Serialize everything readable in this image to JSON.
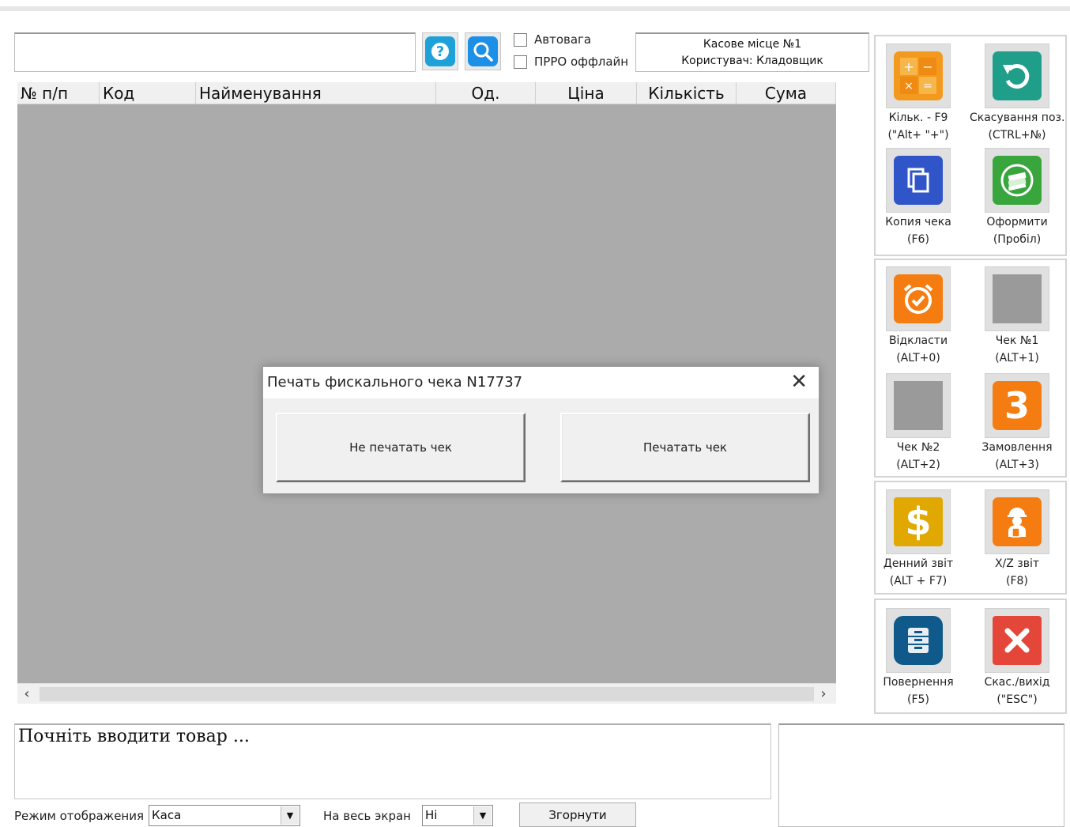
{
  "toolbar": {
    "search_value": "",
    "autoweight_label": "Автовага",
    "prro_offline_label": "ПРРО оффлайн"
  },
  "cash_info": {
    "place": "Касове місце №1",
    "user": "Користувач: Кладовщик"
  },
  "table": {
    "columns": [
      "№ п/п",
      "Код",
      "Найменування",
      "Од.",
      "Ціна",
      "Кількість",
      "Сума"
    ],
    "rows": []
  },
  "dialog": {
    "title": "Печать фискального чека N17737",
    "no_print_label": "Не печатать чек",
    "print_label": "Печатать чек"
  },
  "right_panel": {
    "buttons": [
      {
        "name": "qty",
        "line1": "Кільк. - F9",
        "line2": "(\"Alt+ \"+\")",
        "icon": "calculator-icon",
        "color": "#f39a1e"
      },
      {
        "name": "cancel-position",
        "line1": "Скасування поз.",
        "line2": "(CTRL+№)",
        "icon": "undo-icon",
        "color": "#1f9e8a"
      },
      {
        "name": "copy-receipt",
        "line1": "Копия чека",
        "line2": "(F6)",
        "icon": "copy-icon",
        "color": "#2f55c8"
      },
      {
        "name": "checkout",
        "line1": "Оформити",
        "line2": "(Пробіл)",
        "icon": "cash-stack-icon",
        "color": "#38a63c"
      },
      {
        "name": "postpone",
        "line1": "Відкласти",
        "line2": "(ALT+0)",
        "icon": "alarm-clock-icon",
        "color": "#f57c10"
      },
      {
        "name": "receipt-1",
        "line1": "Чек №1",
        "line2": "(ALT+1)",
        "icon": "blank-icon",
        "color": "#9a9a9a"
      },
      {
        "name": "receipt-2",
        "line1": "Чек №2",
        "line2": "(ALT+2)",
        "icon": "blank-icon",
        "color": "#9a9a9a"
      },
      {
        "name": "order",
        "line1": "Замовлення",
        "line2": "(ALT+3)",
        "icon": "number-three-icon",
        "color": "#f57c10",
        "glyph": "3"
      },
      {
        "name": "daily-report",
        "line1": "Денний звіт",
        "line2": "(ALT + F7)",
        "icon": "dollar-icon",
        "color": "#e0a800",
        "glyph": "$"
      },
      {
        "name": "xz-report",
        "line1": "X/Z звіт",
        "line2": "(F8)",
        "icon": "worker-icon",
        "color": "#f57c10"
      },
      {
        "name": "return",
        "line1": "Повернення",
        "line2": "(F5)",
        "icon": "cabinet-icon",
        "color": "#0f5a8a"
      },
      {
        "name": "cancel-exit",
        "line1": "Скас./вихід",
        "line2": "(\"ESC\")",
        "icon": "close-x-icon",
        "color": "#e5463a"
      }
    ]
  },
  "bottom": {
    "hint": "Почніть вводити товар ...",
    "display_mode_label": "Режим отображения",
    "display_mode_value": "Каса",
    "fullscreen_label": "На весь экран",
    "fullscreen_value": "Ні",
    "collapse_label": "Згорнути"
  }
}
